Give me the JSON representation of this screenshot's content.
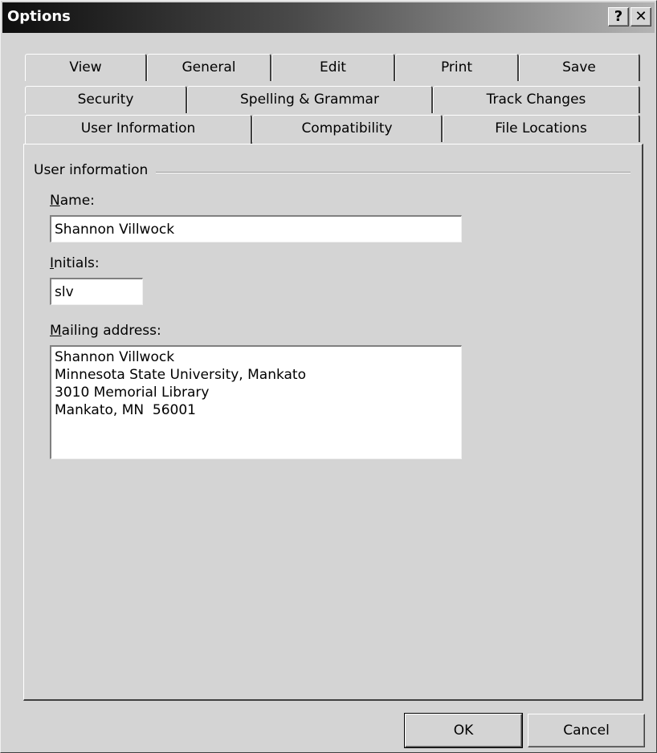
{
  "window": {
    "title": "Options",
    "help_label": "?",
    "close_label": "✕"
  },
  "tabs": {
    "row1": [
      "View",
      "General",
      "Edit",
      "Print",
      "Save"
    ],
    "row2": [
      "Security",
      "Spelling & Grammar",
      "Track Changes"
    ],
    "row3": [
      "User Information",
      "Compatibility",
      "File Locations"
    ],
    "active": "User Information"
  },
  "user_info": {
    "group_label": "User information",
    "name_label_accel": "N",
    "name_label_rest": "ame:",
    "name_value": "Shannon Villwock",
    "initials_label_accel": "I",
    "initials_label_rest": "nitials:",
    "initials_value": "slv",
    "address_label_accel": "M",
    "address_label_rest": "ailing address:",
    "address_value": "Shannon Villwock\nMinnesota State University, Mankato\n3010 Memorial Library\nMankato, MN  56001"
  },
  "buttons": {
    "ok": "OK",
    "cancel": "Cancel"
  }
}
